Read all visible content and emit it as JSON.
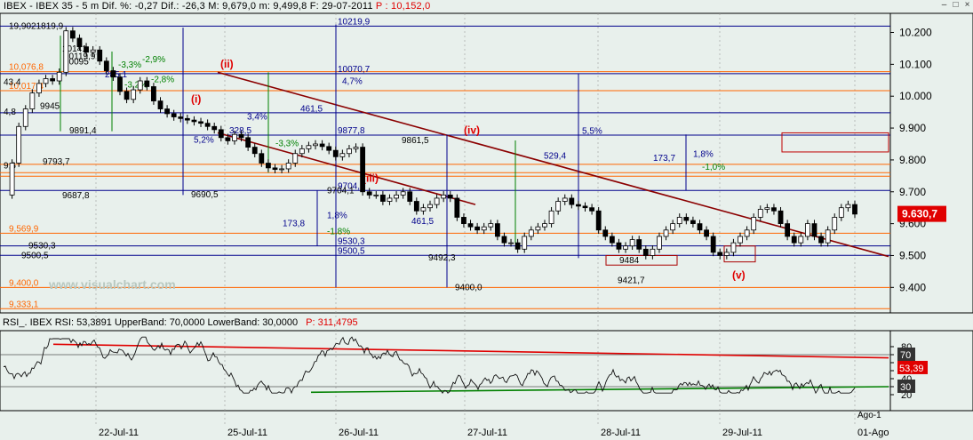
{
  "title": {
    "symbol": "IBEX",
    "name": "IBEX 35",
    "interval": "5 m",
    "dif_pct_label": "Dif. %:",
    "dif_pct": "-0,27",
    "dif_label": "Dif.:",
    "dif": "-26,3",
    "m_label": "M:",
    "m": "9,679,0",
    "m2_label": "m:",
    "m2": "9,499,8",
    "f_label": "F:",
    "f": "29-07-2011",
    "p_label": "P :",
    "p": "10,152,0"
  },
  "watermark": "www.visualchart.com",
  "price_panel": {
    "ylim": [
      9320,
      10260
    ],
    "yticks": [
      "10.200",
      "10.100",
      "10.000",
      "9.900",
      "9.800",
      "9.700",
      "9.600",
      "9.500",
      "9.400"
    ],
    "last_price": "9.630,7",
    "horizontal_levels": [
      {
        "value": 10219.9,
        "label": "10219,9",
        "color": "#00008b"
      },
      {
        "value": 10076.8,
        "label": "10,076,8",
        "color": "#ff6600"
      },
      {
        "value": 10070.7,
        "label": "10070,7",
        "color": "#00008b"
      },
      {
        "value": 10017.4,
        "label": "10,017,4",
        "color": "#ff6600"
      },
      {
        "value": 9948.0,
        "label": "",
        "color": "#00008b"
      },
      {
        "value": 9877.8,
        "label": "9877,8",
        "color": "#00008b"
      },
      {
        "value": 9786.0,
        "label": "",
        "color": "#ff6600"
      },
      {
        "value": 9760.0,
        "label": "",
        "color": "#ff6600"
      },
      {
        "value": 9749.0,
        "label": "",
        "color": "#ff6600"
      },
      {
        "value": 9704.1,
        "label": "9704,1",
        "color": "#00008b"
      },
      {
        "value": 9569.9,
        "label": "9,569,9",
        "color": "#ff6600"
      },
      {
        "value": 9530.3,
        "label": "9530,3",
        "color": "#00008b"
      },
      {
        "value": 9500.5,
        "label": "9500,5",
        "color": "#00008b"
      },
      {
        "value": 9400.0,
        "label": "9,400,0",
        "color": "#ff6600"
      },
      {
        "value": 9333.1,
        "label": "9,333,1",
        "color": "#ff6600"
      }
    ],
    "left_labels": [
      {
        "text": "19,9021819,9",
        "y": 10219.9
      },
      {
        "text": "10141",
        "y": 10148
      },
      {
        "text": "10119,9",
        "y": 10125
      },
      {
        "text": "10095",
        "y": 10108
      },
      {
        "text": "43,4",
        "y": 10043.4
      },
      {
        "text": "9945",
        "y": 9968
      },
      {
        "text": "4,8",
        "y": 9950
      },
      {
        "text": "9891,4",
        "y": 9891.4
      },
      {
        "text": "9793,7",
        "y": 9793.7
      },
      {
        "text": "9,6",
        "y": 9781
      },
      {
        "text": "9687,8",
        "y": 9687.8
      },
      {
        "text": "9530,3",
        "y": 9530.3
      },
      {
        "text": "9500,5",
        "y": 9500.5
      },
      {
        "text": "9492,3",
        "y": 9492.3
      },
      {
        "text": "9421,7",
        "y": 9421.7
      },
      {
        "text": "9400,0",
        "y": 9400.0
      },
      {
        "text": "9690,5",
        "y": 9690.5
      },
      {
        "text": "9704,1",
        "y": 9704.1
      },
      {
        "text": "9861,5",
        "y": 9861.5
      },
      {
        "text": "9484",
        "y": 9484
      }
    ],
    "pct_labels": [
      {
        "text": "-2,9%",
        "y": 10115
      },
      {
        "text": "-3,3%",
        "y": 10098
      },
      {
        "text": "-2,8%",
        "y": 10052
      },
      {
        "text": "-3,2%",
        "y": 10035
      },
      {
        "text": "4,7%",
        "y": 10046
      },
      {
        "text": "5,5%",
        "y": 9890
      },
      {
        "text": "1,8%",
        "y": 9625
      },
      {
        "text": "-1,8%",
        "y": 9575
      },
      {
        "text": "1,8%",
        "y": 9818
      },
      {
        "text": "-1,0%",
        "y": 9778
      },
      {
        "text": "173,8",
        "y": 9600
      },
      {
        "text": "173,7",
        "y": 9805
      },
      {
        "text": "461,5",
        "y": 9960
      },
      {
        "text": "529,4",
        "y": 9813
      },
      {
        "text": "461,5",
        "y": 9607
      },
      {
        "text": "328,5",
        "y": 9892
      },
      {
        "text": "285,1",
        "y": 10068
      },
      {
        "text": "5,2%",
        "y": 9863
      },
      {
        "text": "-3,3%",
        "y": 9852
      },
      {
        "text": "3,4%",
        "y": 9935
      }
    ],
    "wave_labels": [
      "(ii)",
      "(i)",
      "(iii)",
      "(iv)",
      "(v)"
    ]
  },
  "rsi_panel": {
    "label": "RSI_. IBEX RSI: 53,3891 UpperBand: 70,0000 LowerBand: 30,0000",
    "p_label": "P: 311,4795",
    "ylim": [
      0,
      100
    ],
    "yticks": [
      "80",
      "70",
      "60",
      "50",
      "40",
      "30",
      "20"
    ],
    "upper_band": "70",
    "lower_band": "30",
    "last_value": "53,39"
  },
  "x_axis": {
    "labels": [
      "22-Jul-11",
      "25-Jul-11",
      "26-Jul-11",
      "27-Jul-11",
      "28-Jul-11",
      "29-Jul-11",
      "01-Ago",
      "Ago-1"
    ]
  },
  "chart_data": {
    "type": "candlestick",
    "title": "IBEX 35",
    "interval": "5 m",
    "x": [
      "22-Jul-11",
      "25-Jul-11",
      "26-Jul-11",
      "27-Jul-11",
      "28-Jul-11",
      "29-Jul-11",
      "01-Ago"
    ],
    "series": [
      {
        "name": "IBEX 35",
        "close_path": [
          9690,
          9790,
          9905,
          9960,
          10010,
          10040,
          10055,
          10048,
          10075,
          10205,
          10182,
          10155,
          10138,
          10145,
          10110,
          10080,
          10060,
          10015,
          9990,
          10020,
          10048,
          10030,
          9985,
          9960,
          9945,
          9935,
          9930,
          9925,
          9920,
          9915,
          9905,
          9895,
          9870,
          9860,
          9880,
          9870,
          9840,
          9820,
          9790,
          9775,
          9770,
          9772,
          9790,
          9820,
          9835,
          9845,
          9850,
          9842,
          9830,
          9810,
          9820,
          9835,
          9840,
          9700,
          9690,
          9690,
          9670,
          9680,
          9690,
          9700,
          9670,
          9640,
          9650,
          9660,
          9680,
          9690,
          9680,
          9620,
          9600,
          9590,
          9580,
          9590,
          9600,
          9560,
          9540,
          9540,
          9520,
          9560,
          9580,
          9590,
          9600,
          9640,
          9670,
          9680,
          9660,
          9655,
          9650,
          9640,
          9580,
          9560,
          9540,
          9520,
          9530,
          9550,
          9520,
          9500,
          9520,
          9560,
          9580,
          9600,
          9620,
          9610,
          9600,
          9580,
          9560,
          9510,
          9500,
          9510,
          9540,
          9560,
          9580,
          9620,
          9645,
          9650,
          9640,
          9600,
          9560,
          9540,
          9560,
          9600,
          9560,
          9540,
          9580,
          9620,
          9650,
          9660,
          9630
        ]
      }
    ],
    "ylim": [
      9320,
      10260
    ],
    "rsi": {
      "upper_band": 70,
      "lower_band": 30,
      "last": 53.3891
    }
  }
}
